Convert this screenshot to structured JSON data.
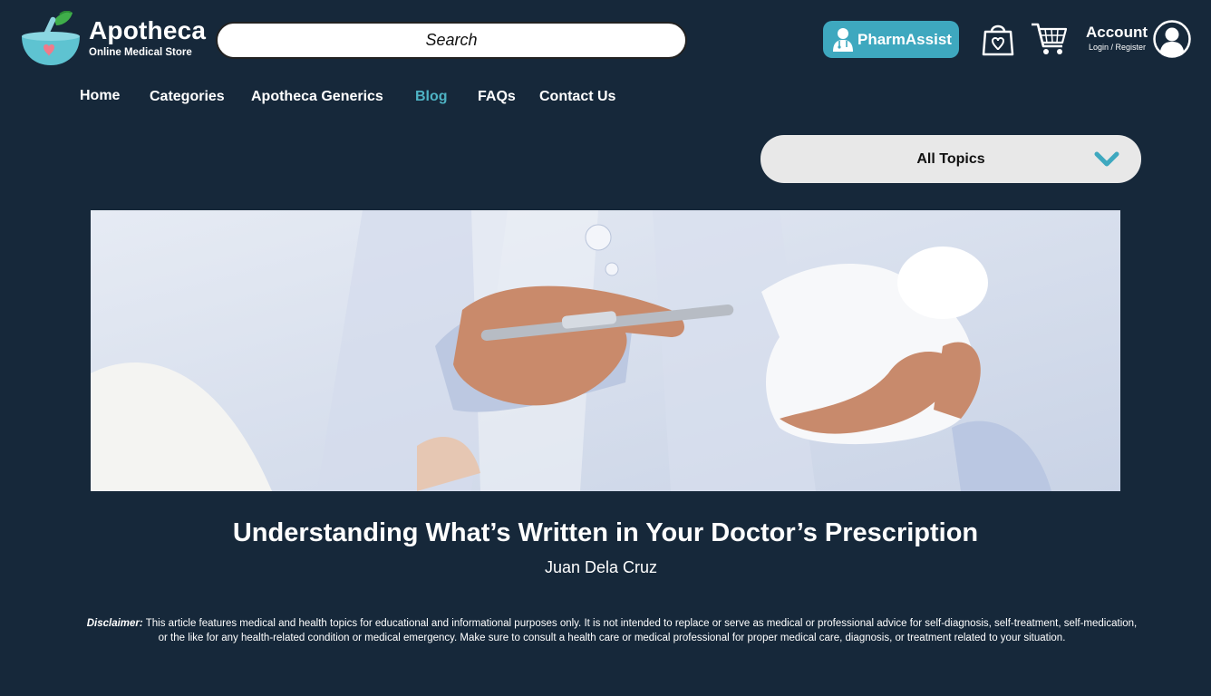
{
  "brand": {
    "name": "Apotheca",
    "tagline": "Online Medical Store"
  },
  "search": {
    "placeholder": "Search"
  },
  "header": {
    "pharmassist_label": "PharmAssist",
    "account_label": "Account",
    "account_sub": "Login / Register"
  },
  "nav": {
    "items": [
      {
        "label": "Home"
      },
      {
        "label": "Categories"
      },
      {
        "label": "Apotheca Generics"
      },
      {
        "label": "Blog",
        "active": true
      },
      {
        "label": "FAQs"
      },
      {
        "label": "Contact Us"
      }
    ]
  },
  "filter": {
    "selected": "All Topics"
  },
  "article": {
    "title": "Understanding What’s Written in Your Doctor’s Prescription",
    "author": "Juan Dela Cruz",
    "disclaimer_label": "Disclaimer:",
    "disclaimer_text": "This article features medical and health topics for educational and informational purposes only. It is not intended to replace or serve as medical or professional advice for self-diagnosis, self-treatment, self-medication, or the like for any health-related condition or medical emergency. Make sure to consult a health care or medical professional for proper medical care, diagnosis, or treatment related to your situation."
  },
  "colors": {
    "background": "#16283a",
    "accent": "#3ea8bf",
    "active_nav": "#4eb3c4"
  },
  "icons": [
    "logo-bowl-icon",
    "doctor-icon",
    "wishlist-bag-icon",
    "cart-icon",
    "user-circle-icon",
    "chevron-down-icon"
  ]
}
